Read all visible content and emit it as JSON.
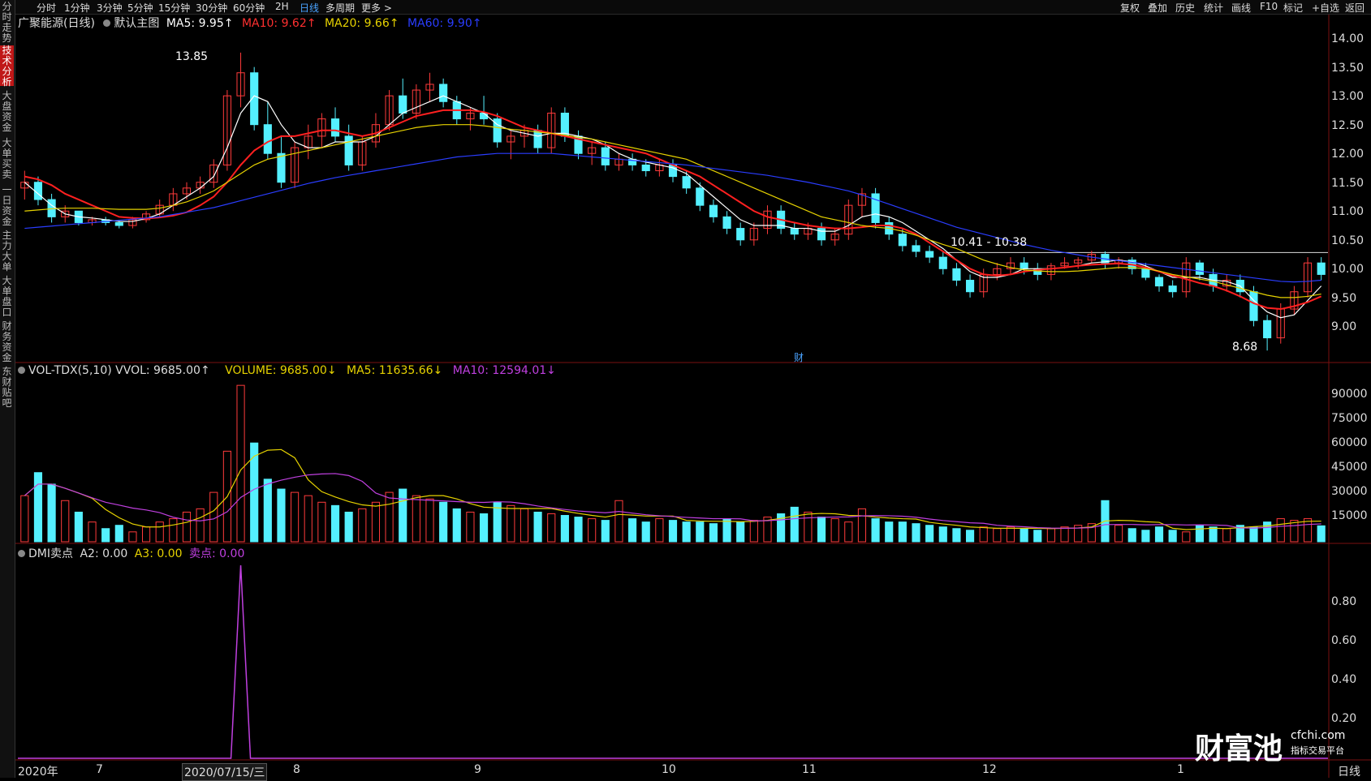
{
  "sidebar": {
    "items": [
      {
        "label": "分时走势"
      },
      {
        "label": "技术分析"
      },
      {
        "label": "大盘资金"
      },
      {
        "label": "大单买卖"
      },
      {
        "label": "一日资金"
      },
      {
        "label": "主力大单"
      },
      {
        "label": "大单盘口"
      },
      {
        "label": "财务资金"
      },
      {
        "label": "东财贴吧"
      }
    ]
  },
  "topbar": {
    "periods": [
      "分时",
      "1分钟",
      "3分钟",
      "5分钟",
      "15分钟",
      "30分钟",
      "60分钟",
      "2H",
      "日线",
      "多周期",
      "更多 >"
    ],
    "active_period": "日线",
    "tools": [
      "复权",
      "叠加",
      "历史",
      "统计",
      "画线",
      "F10",
      "标记",
      "+自选",
      "返回"
    ]
  },
  "main_header": {
    "stock": "广聚能源(日线)",
    "template": "默认主图",
    "ma5": "MA5: 9.95↑",
    "ma10": "MA10: 9.62↑",
    "ma20": "MA20: 9.66↑",
    "ma60": "MA60: 9.90↑"
  },
  "vol_header": {
    "name": "VOL-TDX(5,10)",
    "vvol": "VVOL: 9685.00↑",
    "volume": "VOLUME: 9685.00↓",
    "ma5": "MA5: 11635.66↓",
    "ma10": "MA10: 12594.01↓"
  },
  "dmi_header": {
    "name": "DMI卖点",
    "a2": "A2: 0.00",
    "a3": "A3: 0.00",
    "sell": "卖点: 0.00"
  },
  "annotations": {
    "high": "13.85",
    "low": "8.68",
    "range": "10.41 - 10.38",
    "cai": "财"
  },
  "price_axis": [
    "14.00",
    "13.50",
    "13.00",
    "12.50",
    "12.00",
    "11.50",
    "11.00",
    "10.50",
    "10.00",
    "9.50",
    "9.00"
  ],
  "vol_axis": [
    "90000",
    "75000",
    "60000",
    "45000",
    "30000",
    "15000"
  ],
  "dmi_axis": [
    "0.80",
    "0.60",
    "0.40",
    "0.20"
  ],
  "x_axis": [
    "2020年",
    "7",
    "2020/07/15/三",
    "8",
    "9",
    "10",
    "11",
    "12",
    "1"
  ],
  "corner_label": "日线",
  "watermark": {
    "brand": "财富池",
    "site": "cfchi.com",
    "slogan": "指标交易平台"
  },
  "colors": {
    "up": "#ff3b3b",
    "down": "#54f0ff",
    "ma5": "#ffffff",
    "ma10": "#ff2020",
    "ma20": "#e6d200",
    "ma60": "#2a3dff",
    "purple": "#c040e0",
    "accent": "#4aa3ff"
  },
  "chart_data": {
    "type": "candlestick",
    "ohlc": [
      [
        11.5,
        11.8,
        11.3,
        11.6
      ],
      [
        11.6,
        11.7,
        11.2,
        11.3
      ],
      [
        11.3,
        11.4,
        10.9,
        11.0
      ],
      [
        11.0,
        11.2,
        10.9,
        11.1
      ],
      [
        11.1,
        11.1,
        10.85,
        10.9
      ],
      [
        10.9,
        11.0,
        10.85,
        10.95
      ],
      [
        10.95,
        11.0,
        10.85,
        10.9
      ],
      [
        10.9,
        10.95,
        10.8,
        10.85
      ],
      [
        10.85,
        11.0,
        10.8,
        10.95
      ],
      [
        10.95,
        11.1,
        10.9,
        11.05
      ],
      [
        11.05,
        11.3,
        11.0,
        11.2
      ],
      [
        11.2,
        11.5,
        11.1,
        11.4
      ],
      [
        11.4,
        11.6,
        11.3,
        11.5
      ],
      [
        11.5,
        11.7,
        11.4,
        11.6
      ],
      [
        11.6,
        12.0,
        11.5,
        11.9
      ],
      [
        11.9,
        13.2,
        11.8,
        13.1
      ],
      [
        13.1,
        13.85,
        12.9,
        13.5
      ],
      [
        13.5,
        13.6,
        12.5,
        12.6
      ],
      [
        12.6,
        13.0,
        12.0,
        12.1
      ],
      [
        12.1,
        12.4,
        11.5,
        11.6
      ],
      [
        11.6,
        12.3,
        11.5,
        12.2
      ],
      [
        12.2,
        12.6,
        12.0,
        12.4
      ],
      [
        12.4,
        12.8,
        12.2,
        12.7
      ],
      [
        12.7,
        12.9,
        12.3,
        12.4
      ],
      [
        12.4,
        12.6,
        11.8,
        11.9
      ],
      [
        11.9,
        12.4,
        11.8,
        12.3
      ],
      [
        12.3,
        12.8,
        12.2,
        12.6
      ],
      [
        12.6,
        13.2,
        12.5,
        13.1
      ],
      [
        13.1,
        13.4,
        12.7,
        12.8
      ],
      [
        12.8,
        13.3,
        12.7,
        13.2
      ],
      [
        13.2,
        13.5,
        13.0,
        13.3
      ],
      [
        13.3,
        13.4,
        12.9,
        13.0
      ],
      [
        13.0,
        13.1,
        12.6,
        12.7
      ],
      [
        12.7,
        12.9,
        12.5,
        12.8
      ],
      [
        12.8,
        13.1,
        12.6,
        12.7
      ],
      [
        12.7,
        12.8,
        12.2,
        12.3
      ],
      [
        12.3,
        12.5,
        12.0,
        12.4
      ],
      [
        12.4,
        12.6,
        12.2,
        12.5
      ],
      [
        12.5,
        12.6,
        12.1,
        12.2
      ],
      [
        12.2,
        12.9,
        12.1,
        12.8
      ],
      [
        12.8,
        12.9,
        12.3,
        12.4
      ],
      [
        12.4,
        12.5,
        12.0,
        12.1
      ],
      [
        12.1,
        12.3,
        11.9,
        12.2
      ],
      [
        12.2,
        12.3,
        11.8,
        11.9
      ],
      [
        11.9,
        12.1,
        11.8,
        12.0
      ],
      [
        12.0,
        12.1,
        11.8,
        11.9
      ],
      [
        11.9,
        12.0,
        11.7,
        11.8
      ],
      [
        11.8,
        12.0,
        11.7,
        11.9
      ],
      [
        11.9,
        12.0,
        11.6,
        11.7
      ],
      [
        11.7,
        11.8,
        11.4,
        11.5
      ],
      [
        11.5,
        11.6,
        11.1,
        11.2
      ],
      [
        11.2,
        11.3,
        10.9,
        11.0
      ],
      [
        11.0,
        11.1,
        10.7,
        10.8
      ],
      [
        10.8,
        10.9,
        10.5,
        10.6
      ],
      [
        10.6,
        10.9,
        10.5,
        10.8
      ],
      [
        10.8,
        11.2,
        10.7,
        11.1
      ],
      [
        11.1,
        11.2,
        10.7,
        10.8
      ],
      [
        10.8,
        10.9,
        10.6,
        10.7
      ],
      [
        10.7,
        10.9,
        10.6,
        10.8
      ],
      [
        10.8,
        10.9,
        10.5,
        10.6
      ],
      [
        10.6,
        10.8,
        10.5,
        10.7
      ],
      [
        10.7,
        11.3,
        10.6,
        11.2
      ],
      [
        11.2,
        11.5,
        11.0,
        11.4
      ],
      [
        11.4,
        11.5,
        10.8,
        10.9
      ],
      [
        10.9,
        11.0,
        10.6,
        10.7
      ],
      [
        10.7,
        10.8,
        10.4,
        10.5
      ],
      [
        10.5,
        10.6,
        10.3,
        10.4
      ],
      [
        10.4,
        10.5,
        10.2,
        10.3
      ],
      [
        10.3,
        10.4,
        10.0,
        10.1
      ],
      [
        10.1,
        10.2,
        9.8,
        9.9
      ],
      [
        9.9,
        10.0,
        9.6,
        9.7
      ],
      [
        9.7,
        10.1,
        9.6,
        10.0
      ],
      [
        10.0,
        10.2,
        9.9,
        10.1
      ],
      [
        10.1,
        10.3,
        10.0,
        10.2
      ],
      [
        10.2,
        10.3,
        10.0,
        10.1
      ],
      [
        10.1,
        10.2,
        9.9,
        10.0
      ],
      [
        10.0,
        10.2,
        9.9,
        10.15
      ],
      [
        10.15,
        10.3,
        10.1,
        10.2
      ],
      [
        10.2,
        10.3,
        10.1,
        10.25
      ],
      [
        10.25,
        10.41,
        10.2,
        10.35
      ],
      [
        10.35,
        10.4,
        10.1,
        10.2
      ],
      [
        10.2,
        10.3,
        10.1,
        10.25
      ],
      [
        10.25,
        10.3,
        10.0,
        10.1
      ],
      [
        10.1,
        10.2,
        9.9,
        9.95
      ],
      [
        9.95,
        10.0,
        9.7,
        9.8
      ],
      [
        9.8,
        9.9,
        9.6,
        9.7
      ],
      [
        9.7,
        10.3,
        9.6,
        10.2
      ],
      [
        10.2,
        10.25,
        9.9,
        10.0
      ],
      [
        10.0,
        10.1,
        9.7,
        9.8
      ],
      [
        9.8,
        10.0,
        9.7,
        9.9
      ],
      [
        9.9,
        10.0,
        9.6,
        9.7
      ],
      [
        9.7,
        9.8,
        9.1,
        9.2
      ],
      [
        9.2,
        9.3,
        8.68,
        8.9
      ],
      [
        8.9,
        9.5,
        8.8,
        9.4
      ],
      [
        9.4,
        9.8,
        9.3,
        9.7
      ],
      [
        9.7,
        10.3,
        9.6,
        10.2
      ],
      [
        10.2,
        10.3,
        9.9,
        10.0
      ]
    ],
    "ma_lines": [
      {
        "name": "MA5",
        "color": "#ffffff",
        "values": [
          11.6,
          11.4,
          11.2,
          11.05,
          11.0,
          10.98,
          10.95,
          10.92,
          10.92,
          10.97,
          11.05,
          11.2,
          11.35,
          11.5,
          11.7,
          12.2,
          12.8,
          13.1,
          13.0,
          12.6,
          12.3,
          12.2,
          12.2,
          12.3,
          12.3,
          12.3,
          12.4,
          12.6,
          12.8,
          12.9,
          13.0,
          13.1,
          13.0,
          12.9,
          12.8,
          12.6,
          12.5,
          12.45,
          12.4,
          12.45,
          12.45,
          12.4,
          12.35,
          12.25,
          12.1,
          12.0,
          11.95,
          11.9,
          11.85,
          11.75,
          11.55,
          11.35,
          11.15,
          10.95,
          10.85,
          10.85,
          10.85,
          10.8,
          10.8,
          10.75,
          10.75,
          10.85,
          11.0,
          11.05,
          11.0,
          10.9,
          10.75,
          10.6,
          10.45,
          10.25,
          10.05,
          9.95,
          9.95,
          10.0,
          10.1,
          10.1,
          10.1,
          10.12,
          10.15,
          10.2,
          10.22,
          10.25,
          10.22,
          10.15,
          10.05,
          9.95,
          9.95,
          9.95,
          9.9,
          9.88,
          9.8,
          9.55,
          9.35,
          9.25,
          9.3,
          9.55,
          9.8
        ]
      },
      {
        "name": "MA10",
        "color": "#ff2020",
        "values": [
          11.7,
          11.65,
          11.55,
          11.4,
          11.3,
          11.2,
          11.1,
          11.0,
          10.98,
          10.97,
          10.99,
          11.02,
          11.08,
          11.2,
          11.35,
          11.6,
          11.9,
          12.15,
          12.3,
          12.4,
          12.4,
          12.45,
          12.5,
          12.5,
          12.45,
          12.4,
          12.45,
          12.55,
          12.65,
          12.75,
          12.8,
          12.85,
          12.85,
          12.85,
          12.82,
          12.75,
          12.65,
          12.55,
          12.5,
          12.45,
          12.4,
          12.35,
          12.3,
          12.25,
          12.2,
          12.15,
          12.1,
          12.0,
          11.9,
          11.8,
          11.7,
          11.55,
          11.4,
          11.25,
          11.1,
          11.0,
          10.95,
          10.9,
          10.85,
          10.82,
          10.8,
          10.8,
          10.82,
          10.85,
          10.85,
          10.8,
          10.7,
          10.55,
          10.4,
          10.25,
          10.1,
          10.0,
          9.98,
          10.0,
          10.05,
          10.08,
          10.1,
          10.12,
          10.15,
          10.17,
          10.18,
          10.19,
          10.17,
          10.12,
          10.05,
          9.98,
          9.92,
          9.85,
          9.8,
          9.72,
          9.62,
          9.5,
          9.42,
          9.4,
          9.45,
          9.52,
          9.62
        ]
      },
      {
        "name": "MA20",
        "color": "#e6d200",
        "values": [
          11.1,
          11.12,
          11.14,
          11.15,
          11.15,
          11.15,
          11.14,
          11.13,
          11.13,
          11.13,
          11.15,
          11.2,
          11.26,
          11.35,
          11.45,
          11.6,
          11.75,
          11.9,
          12.0,
          12.05,
          12.1,
          12.15,
          12.2,
          12.25,
          12.3,
          12.35,
          12.4,
          12.45,
          12.5,
          12.55,
          12.58,
          12.6,
          12.6,
          12.6,
          12.58,
          12.55,
          12.52,
          12.5,
          12.47,
          12.45,
          12.42,
          12.38,
          12.35,
          12.3,
          12.25,
          12.2,
          12.15,
          12.1,
          12.05,
          12.0,
          11.9,
          11.8,
          11.7,
          11.6,
          11.5,
          11.4,
          11.3,
          11.2,
          11.1,
          11.0,
          10.95,
          10.9,
          10.85,
          10.82,
          10.8,
          10.75,
          10.68,
          10.6,
          10.52,
          10.45,
          10.35,
          10.25,
          10.18,
          10.12,
          10.08,
          10.06,
          10.05,
          10.05,
          10.06,
          10.08,
          10.1,
          10.12,
          10.12,
          10.1,
          10.06,
          10.0,
          9.96,
          9.92,
          9.88,
          9.82,
          9.76,
          9.7,
          9.64,
          9.6,
          9.6,
          9.62,
          9.66
        ]
      },
      {
        "name": "MA60",
        "color": "#2a3dff",
        "values": [
          10.8,
          10.82,
          10.84,
          10.86,
          10.88,
          10.9,
          10.92,
          10.94,
          10.96,
          10.98,
          11.0,
          11.04,
          11.08,
          11.12,
          11.16,
          11.22,
          11.28,
          11.34,
          11.4,
          11.46,
          11.52,
          11.58,
          11.63,
          11.68,
          11.72,
          11.76,
          11.8,
          11.84,
          11.88,
          11.92,
          11.96,
          12.0,
          12.04,
          12.06,
          12.08,
          12.1,
          12.1,
          12.1,
          12.1,
          12.1,
          12.08,
          12.06,
          12.04,
          12.02,
          12.0,
          11.98,
          11.96,
          11.94,
          11.92,
          11.9,
          11.87,
          11.84,
          11.81,
          11.78,
          11.75,
          11.72,
          11.68,
          11.64,
          11.6,
          11.55,
          11.5,
          11.45,
          11.38,
          11.3,
          11.22,
          11.14,
          11.06,
          10.98,
          10.9,
          10.82,
          10.76,
          10.7,
          10.64,
          10.58,
          10.52,
          10.47,
          10.42,
          10.38,
          10.34,
          10.3,
          10.27,
          10.24,
          10.21,
          10.18,
          10.15,
          10.12,
          10.09,
          10.06,
          10.03,
          10.0,
          9.97,
          9.94,
          9.91,
          9.88,
          9.87,
          9.88,
          9.9
        ]
      }
    ],
    "volume": [
      28000,
      42000,
      35000,
      25000,
      18000,
      12000,
      8000,
      10000,
      6000,
      9000,
      12000,
      14000,
      18000,
      20000,
      30000,
      55000,
      95000,
      60000,
      38000,
      32000,
      30000,
      28000,
      24000,
      22000,
      18000,
      20000,
      24000,
      30000,
      32000,
      28000,
      26000,
      24000,
      20000,
      18000,
      17000,
      24000,
      22000,
      20000,
      18000,
      17000,
      16000,
      15000,
      14000,
      13000,
      25000,
      14000,
      12000,
      14000,
      13000,
      12000,
      12000,
      11000,
      14000,
      12000,
      13000,
      15000,
      17000,
      21000,
      18000,
      15000,
      14000,
      12000,
      20000,
      14000,
      12000,
      12000,
      11000,
      10000,
      9000,
      8000,
      7000,
      9000,
      8000,
      9000,
      8000,
      7000,
      8000,
      9000,
      10000,
      11000,
      25000,
      10000,
      8000,
      7000,
      9000,
      7000,
      6000,
      10000,
      9000,
      8000,
      10000,
      9000,
      12000,
      14000,
      13000,
      14000,
      9685
    ],
    "dmi_sell": {
      "peak_index": 16,
      "value": 1.0
    },
    "price_range": [
      8.5,
      14.2
    ],
    "volume_range": [
      0,
      100000
    ],
    "dmi_range": [
      0,
      1.0
    ]
  }
}
